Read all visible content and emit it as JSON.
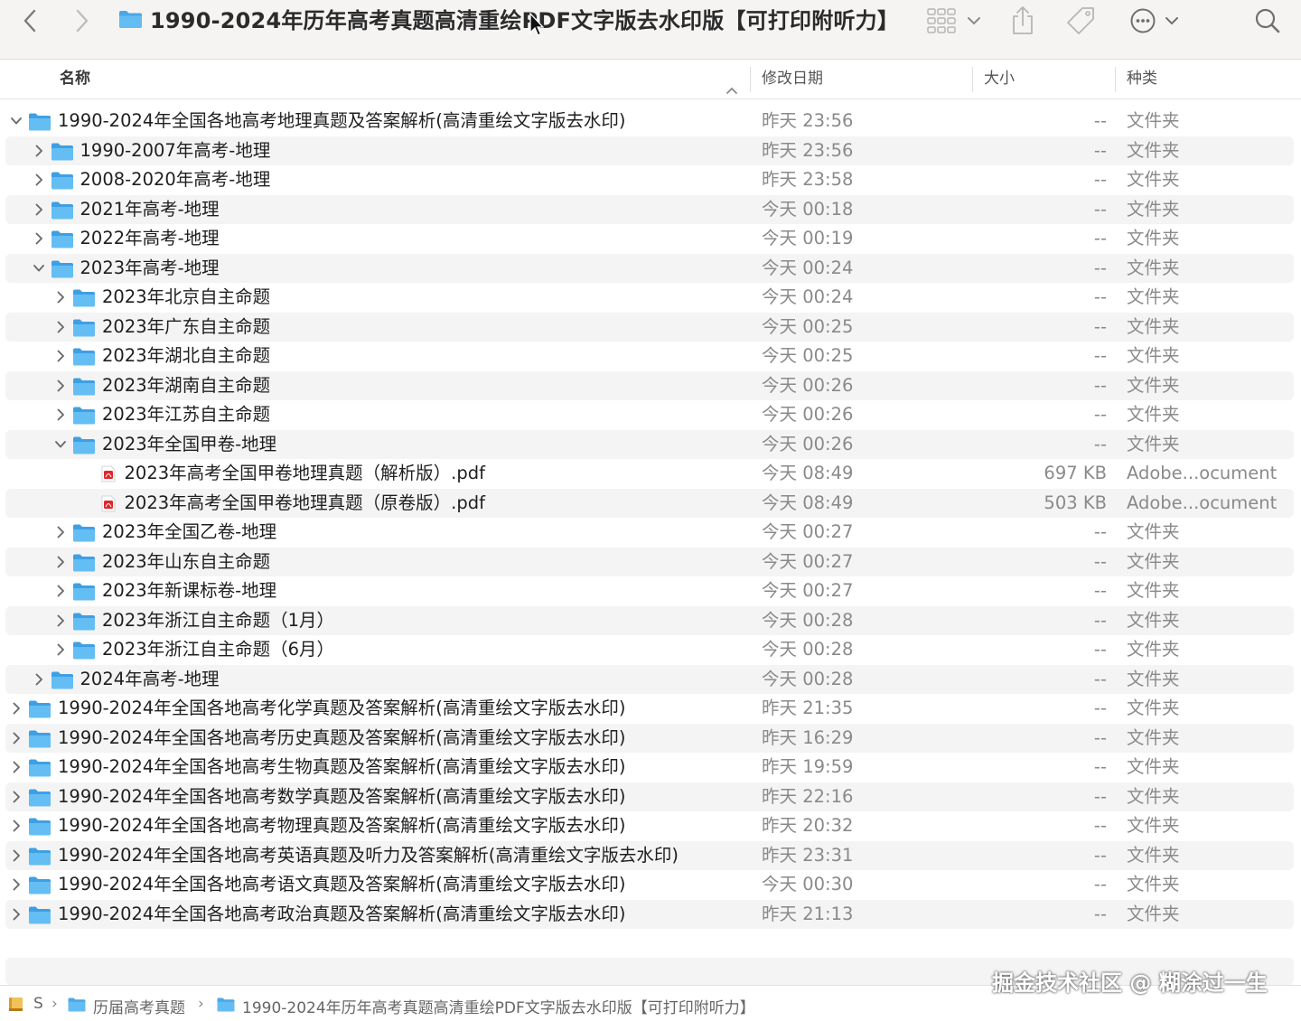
{
  "window": {
    "title": "1990-2024年历年高考真题高清重绘PDF文字版去水印版【可打印附听力】"
  },
  "columns": {
    "name": "名称",
    "date": "修改日期",
    "size": "大小",
    "kind": "种类"
  },
  "rows": [
    {
      "name": "1990-2024年全国各地高考地理真题及答案解析(高清重绘文字版去水印)",
      "date": "昨天 23:56",
      "size": "--",
      "kind": "文件夹",
      "level": 0,
      "expanded": true,
      "type": "folder"
    },
    {
      "name": "1990-2007年高考-地理",
      "date": "昨天 23:56",
      "size": "--",
      "kind": "文件夹",
      "level": 1,
      "expanded": false,
      "type": "folder"
    },
    {
      "name": "2008-2020年高考-地理",
      "date": "昨天 23:58",
      "size": "--",
      "kind": "文件夹",
      "level": 1,
      "expanded": false,
      "type": "folder"
    },
    {
      "name": "2021年高考-地理",
      "date": "今天 00:18",
      "size": "--",
      "kind": "文件夹",
      "level": 1,
      "expanded": false,
      "type": "folder"
    },
    {
      "name": "2022年高考-地理",
      "date": "今天 00:19",
      "size": "--",
      "kind": "文件夹",
      "level": 1,
      "expanded": false,
      "type": "folder"
    },
    {
      "name": "2023年高考-地理",
      "date": "今天 00:24",
      "size": "--",
      "kind": "文件夹",
      "level": 1,
      "expanded": true,
      "type": "folder"
    },
    {
      "name": "2023年北京自主命题",
      "date": "今天 00:24",
      "size": "--",
      "kind": "文件夹",
      "level": 2,
      "expanded": false,
      "type": "folder"
    },
    {
      "name": "2023年广东自主命题",
      "date": "今天 00:25",
      "size": "--",
      "kind": "文件夹",
      "level": 2,
      "expanded": false,
      "type": "folder"
    },
    {
      "name": "2023年湖北自主命题",
      "date": "今天 00:25",
      "size": "--",
      "kind": "文件夹",
      "level": 2,
      "expanded": false,
      "type": "folder"
    },
    {
      "name": "2023年湖南自主命题",
      "date": "今天 00:26",
      "size": "--",
      "kind": "文件夹",
      "level": 2,
      "expanded": false,
      "type": "folder"
    },
    {
      "name": "2023年江苏自主命题",
      "date": "今天 00:26",
      "size": "--",
      "kind": "文件夹",
      "level": 2,
      "expanded": false,
      "type": "folder"
    },
    {
      "name": "2023年全国甲卷-地理",
      "date": "今天 00:26",
      "size": "--",
      "kind": "文件夹",
      "level": 2,
      "expanded": true,
      "type": "folder"
    },
    {
      "name": "2023年高考全国甲卷地理真题（解析版）.pdf",
      "date": "今天 08:49",
      "size": "697 KB",
      "kind": "Adobe...ocument",
      "level": 3,
      "expanded": false,
      "type": "pdf"
    },
    {
      "name": "2023年高考全国甲卷地理真题（原卷版）.pdf",
      "date": "今天 08:49",
      "size": "503 KB",
      "kind": "Adobe...ocument",
      "level": 3,
      "expanded": false,
      "type": "pdf"
    },
    {
      "name": "2023年全国乙卷-地理",
      "date": "今天 00:27",
      "size": "--",
      "kind": "文件夹",
      "level": 2,
      "expanded": false,
      "type": "folder"
    },
    {
      "name": "2023年山东自主命题",
      "date": "今天 00:27",
      "size": "--",
      "kind": "文件夹",
      "level": 2,
      "expanded": false,
      "type": "folder"
    },
    {
      "name": "2023年新课标卷-地理",
      "date": "今天 00:27",
      "size": "--",
      "kind": "文件夹",
      "level": 2,
      "expanded": false,
      "type": "folder"
    },
    {
      "name": "2023年浙江自主命题（1月）",
      "date": "今天 00:28",
      "size": "--",
      "kind": "文件夹",
      "level": 2,
      "expanded": false,
      "type": "folder"
    },
    {
      "name": "2023年浙江自主命题（6月）",
      "date": "今天 00:28",
      "size": "--",
      "kind": "文件夹",
      "level": 2,
      "expanded": false,
      "type": "folder"
    },
    {
      "name": "2024年高考-地理",
      "date": "今天 00:28",
      "size": "--",
      "kind": "文件夹",
      "level": 1,
      "expanded": false,
      "type": "folder"
    },
    {
      "name": "1990-2024年全国各地高考化学真题及答案解析(高清重绘文字版去水印)",
      "date": "昨天 21:35",
      "size": "--",
      "kind": "文件夹",
      "level": 0,
      "expanded": false,
      "type": "folder"
    },
    {
      "name": "1990-2024年全国各地高考历史真题及答案解析(高清重绘文字版去水印)",
      "date": "昨天 16:29",
      "size": "--",
      "kind": "文件夹",
      "level": 0,
      "expanded": false,
      "type": "folder"
    },
    {
      "name": "1990-2024年全国各地高考生物真题及答案解析(高清重绘文字版去水印)",
      "date": "昨天 19:59",
      "size": "--",
      "kind": "文件夹",
      "level": 0,
      "expanded": false,
      "type": "folder"
    },
    {
      "name": "1990-2024年全国各地高考数学真题及答案解析(高清重绘文字版去水印)",
      "date": "昨天 22:16",
      "size": "--",
      "kind": "文件夹",
      "level": 0,
      "expanded": false,
      "type": "folder"
    },
    {
      "name": "1990-2024年全国各地高考物理真题及答案解析(高清重绘文字版去水印)",
      "date": "昨天 20:32",
      "size": "--",
      "kind": "文件夹",
      "level": 0,
      "expanded": false,
      "type": "folder"
    },
    {
      "name": "1990-2024年全国各地高考英语真题及听力及答案解析(高清重绘文字版去水印)",
      "date": "昨天 23:31",
      "size": "--",
      "kind": "文件夹",
      "level": 0,
      "expanded": false,
      "type": "folder"
    },
    {
      "name": "1990-2024年全国各地高考语文真题及答案解析(高清重绘文字版去水印)",
      "date": "今天 00:30",
      "size": "--",
      "kind": "文件夹",
      "level": 0,
      "expanded": false,
      "type": "folder"
    },
    {
      "name": "1990-2024年全国各地高考政治真题及答案解析(高清重绘文字版去水印)",
      "date": "昨天 21:13",
      "size": "--",
      "kind": "文件夹",
      "level": 0,
      "expanded": false,
      "type": "folder"
    }
  ],
  "pathbar": {
    "items": [
      "S",
      "历届高考真题",
      "1990-2024年历年高考真题高清重绘PDF文字版去水印版【可打印附听力】"
    ]
  },
  "watermark": "掘金技术社区 @ 糊涂过一生",
  "colors": {
    "folder_blue": "#5cb8f0",
    "alt_row": "#f4f4f4",
    "secondary_text": "#8a8a8a",
    "pdf_red": "#e0252b"
  }
}
